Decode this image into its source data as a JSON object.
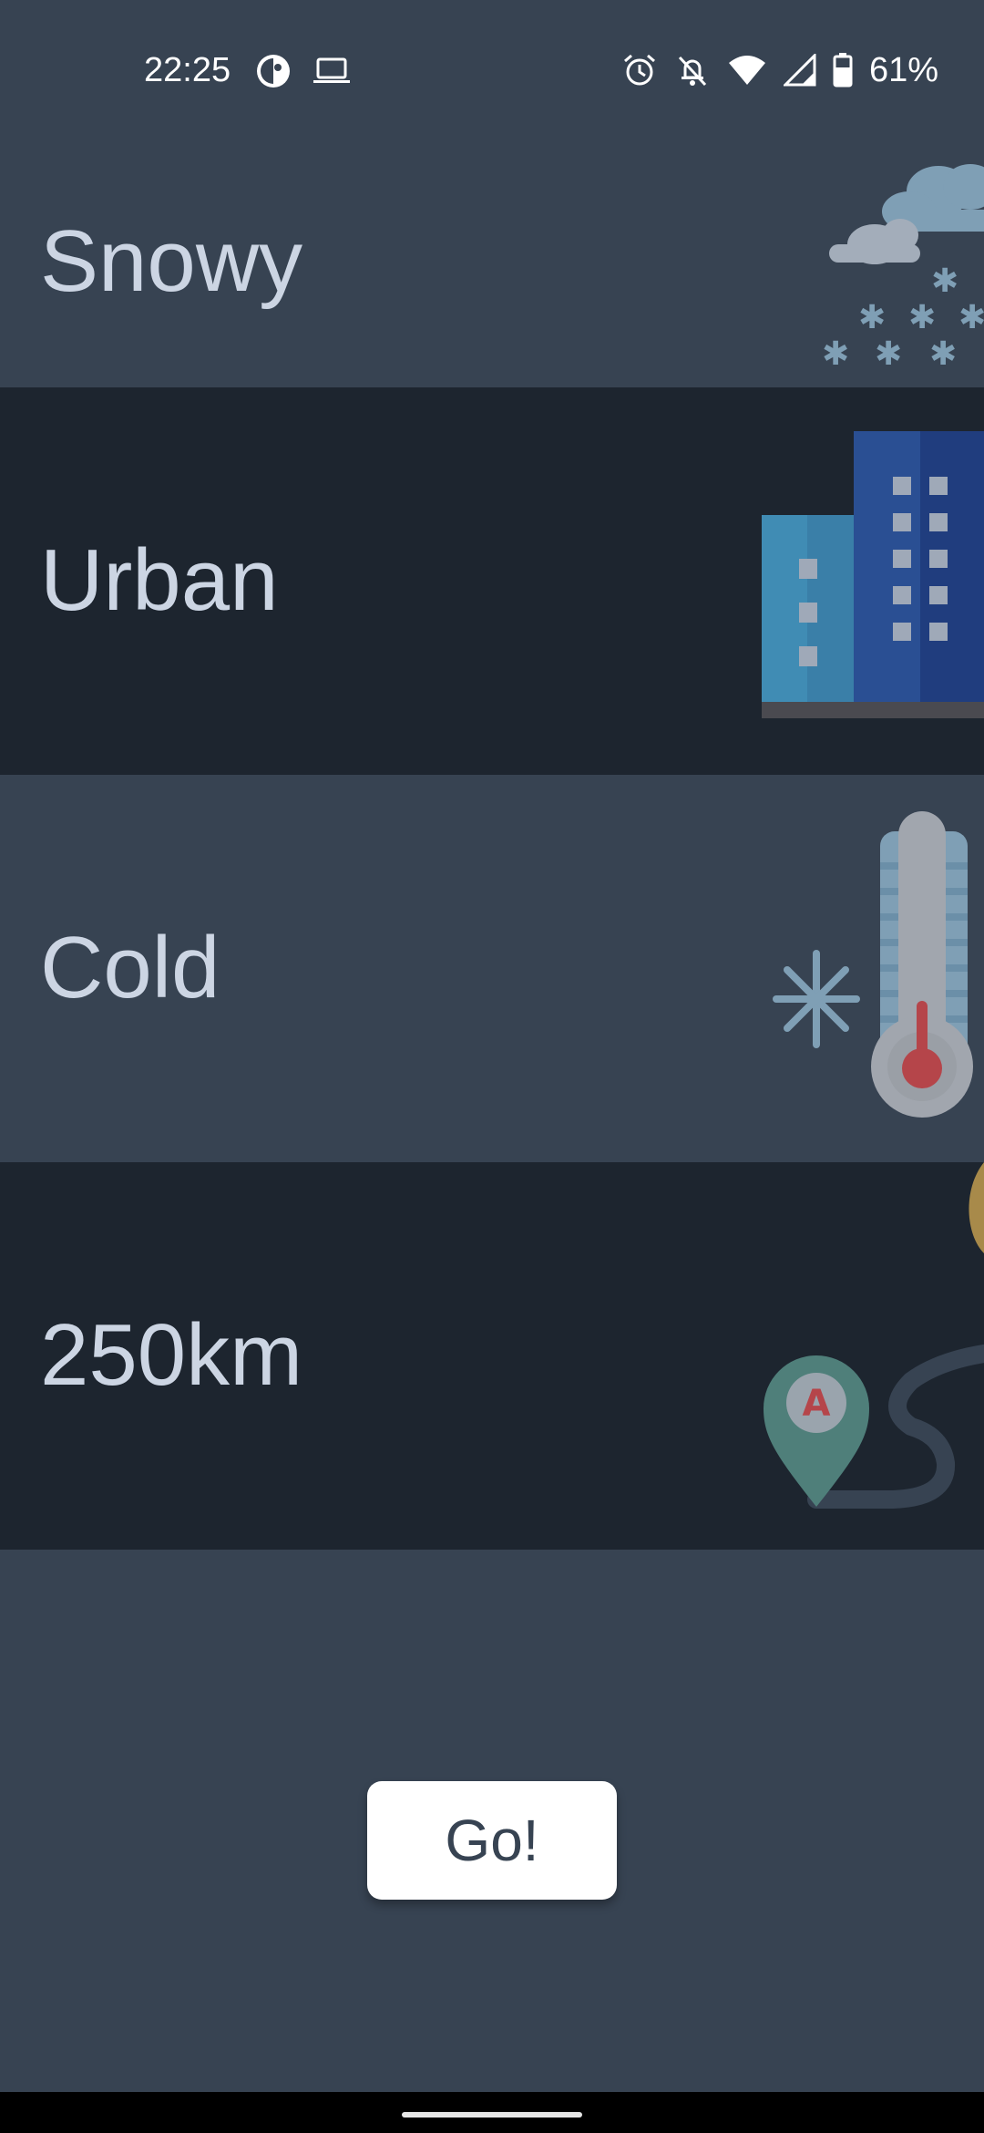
{
  "status_bar": {
    "time": "22:25",
    "left_icons": [
      "incognito-icon",
      "laptop-icon"
    ],
    "right_icons": [
      "alarm-icon",
      "notifications-off-icon",
      "wifi-icon",
      "cellular-signal-icon",
      "battery-icon"
    ],
    "battery_percent": "61%"
  },
  "conditions": [
    {
      "label": "Snowy",
      "icon": "snowy-weather-icon"
    },
    {
      "label": "Urban",
      "icon": "city-buildings-icon"
    },
    {
      "label": "Cold",
      "icon": "thermometer-cold-icon"
    },
    {
      "label": "250km",
      "icon": "route-map-pin-icon"
    }
  ],
  "go_button": {
    "label": "Go!"
  },
  "colors": {
    "row_light": "#374352",
    "row_dark": "#1d252f",
    "label_text": "#ccd5e3",
    "button_bg": "#ffffff",
    "button_text": "#374352"
  }
}
